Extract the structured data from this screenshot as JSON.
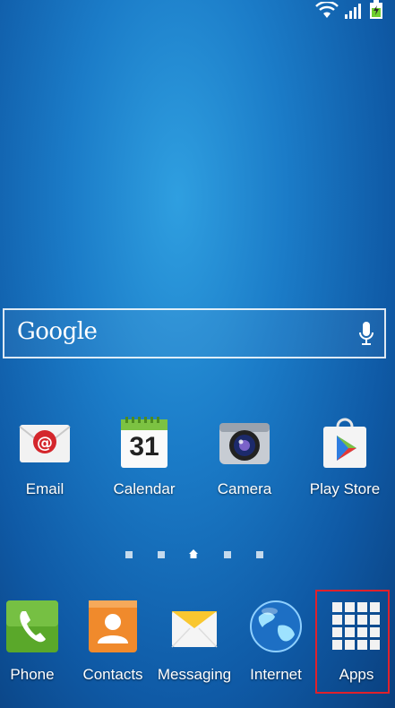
{
  "search": {
    "brand_text": "Google"
  },
  "apps": [
    {
      "label": "Email",
      "icon": "email-icon"
    },
    {
      "label": "Calendar",
      "icon": "calendar-icon",
      "badge": "31"
    },
    {
      "label": "Camera",
      "icon": "camera-icon"
    },
    {
      "label": "Play Store",
      "icon": "play-store-icon"
    }
  ],
  "dock": [
    {
      "label": "Phone",
      "icon": "phone-icon"
    },
    {
      "label": "Contacts",
      "icon": "contacts-icon"
    },
    {
      "label": "Messaging",
      "icon": "messaging-icon"
    },
    {
      "label": "Internet",
      "icon": "globe-icon"
    },
    {
      "label": "Apps",
      "icon": "apps-grid-icon"
    }
  ],
  "colors": {
    "highlight": "#e0212b",
    "wallpaper": "#1b7cc8"
  }
}
